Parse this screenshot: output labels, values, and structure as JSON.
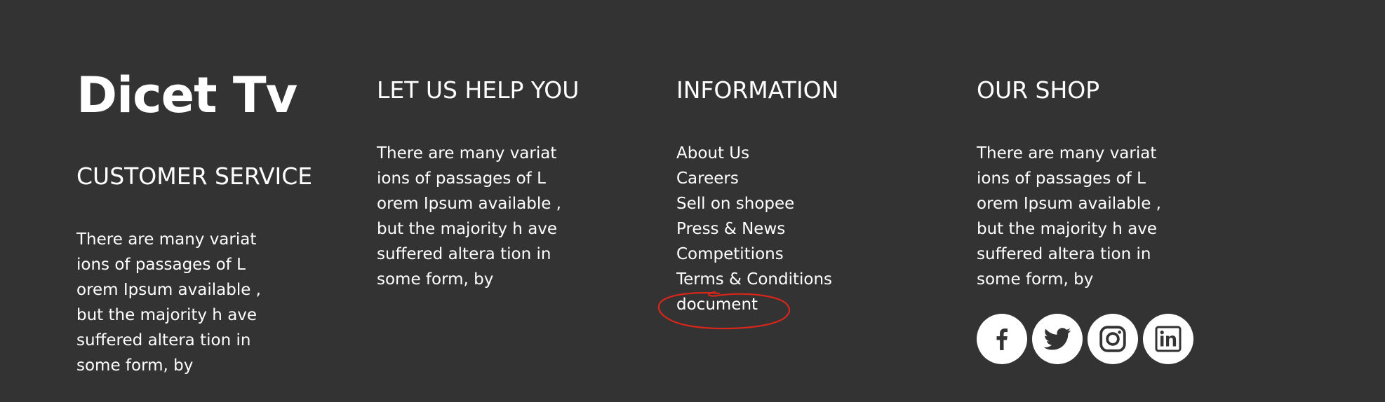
{
  "brand": {
    "logo_text": "Dicet Tv"
  },
  "customer_service": {
    "heading": "CUSTOMER SERVICE",
    "lines": [
      "There are many variat",
      "ions of passages of L",
      "orem Ipsum available ,",
      "but the majority h ave",
      "suffered altera tion in",
      "some form, by"
    ]
  },
  "help": {
    "heading": "LET US HELP YOU",
    "lines": [
      "There are many variat",
      "ions of passages of L",
      "orem Ipsum available ,",
      "but the majority h ave",
      "suffered altera tion in",
      "some form, by"
    ]
  },
  "information": {
    "heading": "INFORMATION",
    "links": [
      "About Us",
      "Careers",
      "Sell on shopee",
      "Press & News",
      "Competitions",
      "Terms & Conditions",
      "document"
    ]
  },
  "shop": {
    "heading": "OUR SHOP",
    "lines": [
      "There are many variat",
      "ions of passages of L",
      "orem Ipsum available ,",
      "but the majority h ave",
      "suffered altera tion in",
      "some form, by"
    ],
    "socials": [
      {
        "icon": "facebook-icon"
      },
      {
        "icon": "twitter-icon"
      },
      {
        "icon": "instagram-icon"
      },
      {
        "icon": "linkedin-icon"
      }
    ]
  },
  "colors": {
    "background": "#333333",
    "text": "#ffffff",
    "annotation": "#d8261b",
    "icon": "#333333"
  }
}
